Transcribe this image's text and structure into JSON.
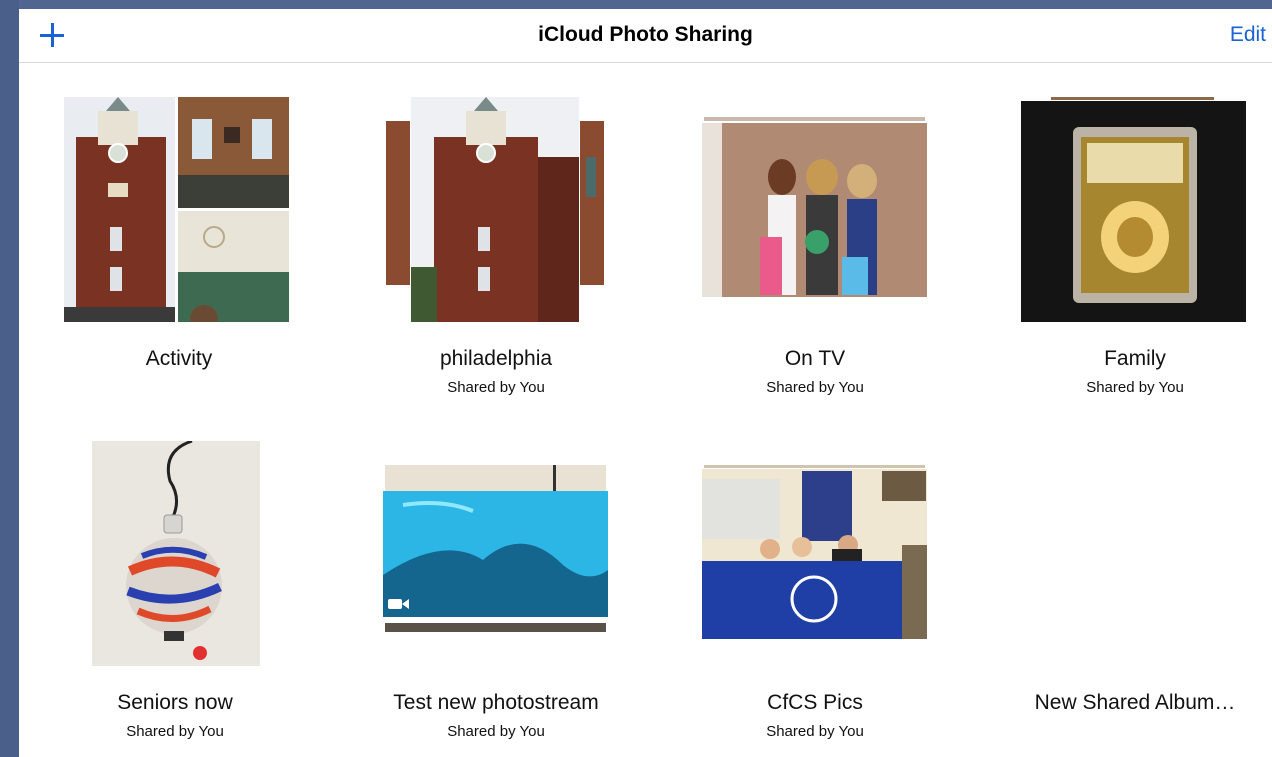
{
  "nav": {
    "title": "iCloud Photo Sharing",
    "add_icon": "plus-icon",
    "edit_label": "Edit",
    "accent": "#1a62d6"
  },
  "albums": [
    {
      "title": "Activity",
      "subtitle": ""
    },
    {
      "title": "philadelphia",
      "subtitle": "Shared by You"
    },
    {
      "title": "On TV",
      "subtitle": "Shared by You"
    },
    {
      "title": "Family",
      "subtitle": "Shared by You"
    },
    {
      "title": "Seniors now",
      "subtitle": "Shared by You"
    },
    {
      "title": "Test new photostream",
      "subtitle": "Shared by You"
    },
    {
      "title": "CfCS Pics",
      "subtitle": "Shared by You"
    },
    {
      "title": "New Shared Album…",
      "subtitle": ""
    }
  ]
}
